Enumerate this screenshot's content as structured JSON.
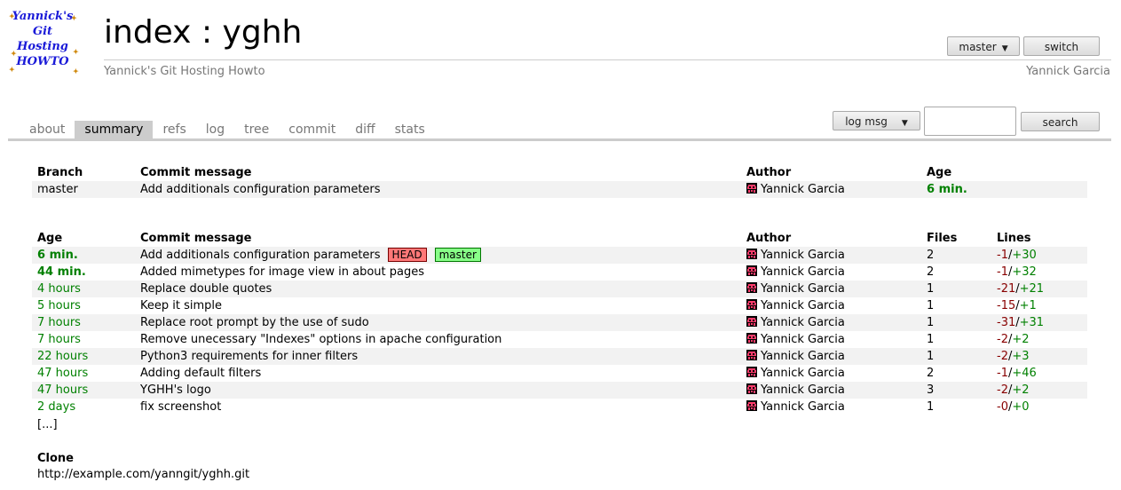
{
  "logo": {
    "lines": [
      "Yannick's",
      "Git",
      "Hosting",
      "HOWTO"
    ]
  },
  "header": {
    "index_word": "index",
    "separator": ":",
    "repo_name": "yghh",
    "description": "Yannick's Git Hosting Howto",
    "owner": "Yannick Garcia",
    "branch_select": "master",
    "switch_label": "switch"
  },
  "tabs": [
    {
      "label": "about",
      "active": false
    },
    {
      "label": "summary",
      "active": true
    },
    {
      "label": "refs",
      "active": false
    },
    {
      "label": "log",
      "active": false
    },
    {
      "label": "tree",
      "active": false
    },
    {
      "label": "commit",
      "active": false
    },
    {
      "label": "diff",
      "active": false
    },
    {
      "label": "stats",
      "active": false
    }
  ],
  "search": {
    "mode_select": "log msg",
    "query": "",
    "button_label": "search"
  },
  "branches": {
    "headers": {
      "branch": "Branch",
      "message": "Commit message",
      "author": "Author",
      "age": "Age"
    },
    "rows": [
      {
        "branch": "master",
        "message": "Add additionals configuration parameters",
        "author": "Yannick Garcia",
        "age": "6 min."
      }
    ]
  },
  "log": {
    "headers": {
      "age": "Age",
      "message": "Commit message",
      "author": "Author",
      "files": "Files",
      "lines": "Lines"
    },
    "head_badge": "HEAD",
    "branch_badge": "master",
    "rows": [
      {
        "age": "6 min.",
        "age_style": "recent",
        "message": "Add additionals configuration parameters",
        "author": "Yannick Garcia",
        "files": "2",
        "del": "-1",
        "ins": "+30"
      },
      {
        "age": "44 min.",
        "age_style": "recent",
        "message": "Added mimetypes for image view in about pages",
        "author": "Yannick Garcia",
        "files": "2",
        "del": "-1",
        "ins": "+32"
      },
      {
        "age": "4 hours",
        "age_style": "hours",
        "message": "Replace double quotes",
        "author": "Yannick Garcia",
        "files": "1",
        "del": "-21",
        "ins": "+21"
      },
      {
        "age": "5 hours",
        "age_style": "hours",
        "message": "Keep it simple",
        "author": "Yannick Garcia",
        "files": "1",
        "del": "-15",
        "ins": "+1"
      },
      {
        "age": "7 hours",
        "age_style": "hours",
        "message": "Replace root prompt by the use of sudo",
        "author": "Yannick Garcia",
        "files": "1",
        "del": "-31",
        "ins": "+31"
      },
      {
        "age": "7 hours",
        "age_style": "hours",
        "message": "Remove unecessary \"Indexes\" options in apache configuration",
        "author": "Yannick Garcia",
        "files": "1",
        "del": "-2",
        "ins": "+2"
      },
      {
        "age": "22 hours",
        "age_style": "hours",
        "message": "Python3 requirements for inner filters",
        "author": "Yannick Garcia",
        "files": "1",
        "del": "-2",
        "ins": "+3"
      },
      {
        "age": "47 hours",
        "age_style": "hours",
        "message": "Adding default filters",
        "author": "Yannick Garcia",
        "files": "2",
        "del": "-1",
        "ins": "+46"
      },
      {
        "age": "47 hours",
        "age_style": "hours",
        "message": "YGHH's logo",
        "author": "Yannick Garcia",
        "files": "3",
        "del": "-2",
        "ins": "+2"
      },
      {
        "age": "2 days",
        "age_style": "days",
        "message": "fix screenshot",
        "author": "Yannick Garcia",
        "files": "1",
        "del": "-0",
        "ins": "+0"
      }
    ],
    "more": "[...]"
  },
  "clone": {
    "label": "Clone",
    "url": "http://example.com/yanngit/yghh.git"
  },
  "colors": {
    "tab_active_bg": "#cccccc",
    "age_green": "#008000",
    "deletions": "#880000",
    "insertions": "#008000",
    "head_badge_bg": "#ff7878",
    "branch_badge_bg": "#88ff88"
  }
}
